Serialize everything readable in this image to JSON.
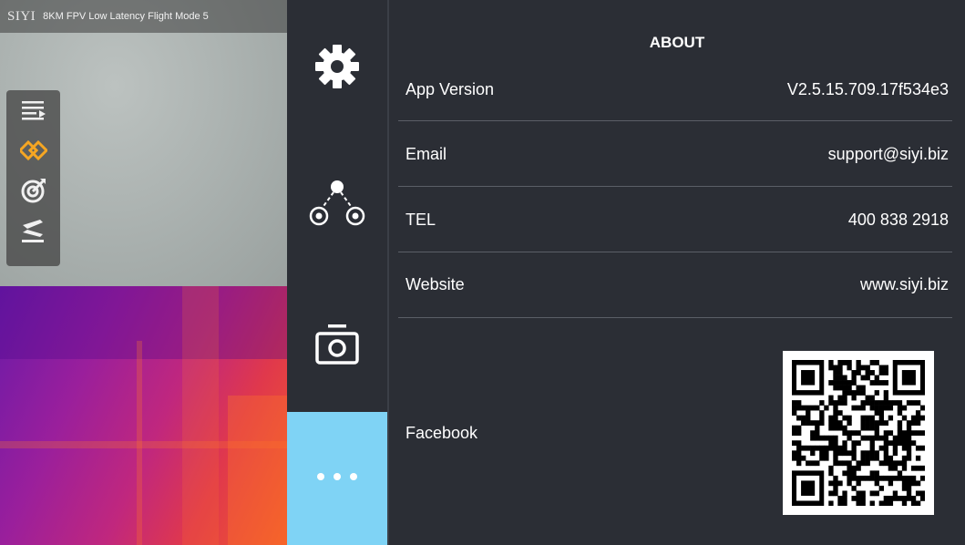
{
  "header": {
    "brand": "SIYI",
    "mode_text": "8KM FPV Low Latency Flight Mode 5"
  },
  "tools": [
    {
      "icon": "list-play-icon"
    },
    {
      "icon": "link-diamond-icon",
      "active": true
    },
    {
      "icon": "target-icon"
    },
    {
      "icon": "takeoff-land-icon"
    }
  ],
  "nav": [
    {
      "icon": "gear-icon"
    },
    {
      "icon": "network-nodes-icon"
    },
    {
      "icon": "camera-icon"
    },
    {
      "icon": "more-dots-icon",
      "active": true
    }
  ],
  "about": {
    "title": "ABOUT",
    "rows": [
      {
        "label": "App Version",
        "value": "V2.5.15.709.17f534e3"
      },
      {
        "label": "Email",
        "value": "support@siyi.biz"
      },
      {
        "label": "TEL",
        "value": "400 838 2918"
      },
      {
        "label": "Website",
        "value": "www.siyi.biz"
      }
    ],
    "facebook_label": "Facebook"
  },
  "colors": {
    "panel_bg": "#2b2e35",
    "active_nav": "#7fd3f5",
    "tool_accent": "#f5a623"
  }
}
